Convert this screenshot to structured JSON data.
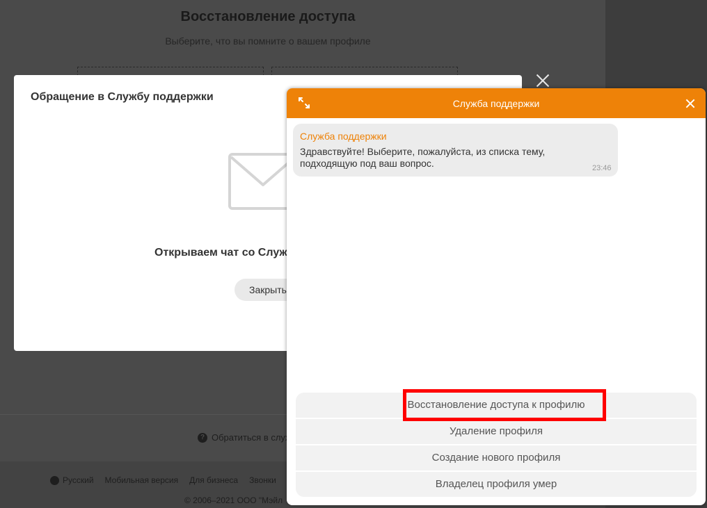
{
  "background": {
    "title": "Восстановление доступа",
    "subtitle": "Выберите, что вы помните о вашем профиле",
    "contact_link": "Обратиться в служ",
    "footer_links": [
      "Русский",
      "Мобильная версия",
      "Для бизнеса",
      "Звонки"
    ],
    "copyright": "© 2006–2021 ООО \"Мэйл"
  },
  "modal": {
    "title": "Обращение в Службу поддержки",
    "status": "Открываем чат со Служ",
    "close_label": "Закрыть"
  },
  "chat": {
    "header_title": "Служба поддержки",
    "accent_color": "#ee8208",
    "messages": [
      {
        "sender": "Служба поддержки",
        "text": "Здравствуйте! Выберите, пожалуйста, из списка тему, подходящую под ваш вопрос.",
        "time": "23:46"
      }
    ],
    "options": [
      "Восстановление доступа к профилю",
      "Удаление профиля",
      "Создание нового профиля",
      "Владелец профиля умер"
    ],
    "highlight_color": "#ff0000"
  },
  "icons": [
    "expand-icon",
    "close-icon",
    "envelope-icon",
    "help-icon",
    "globe-icon"
  ]
}
